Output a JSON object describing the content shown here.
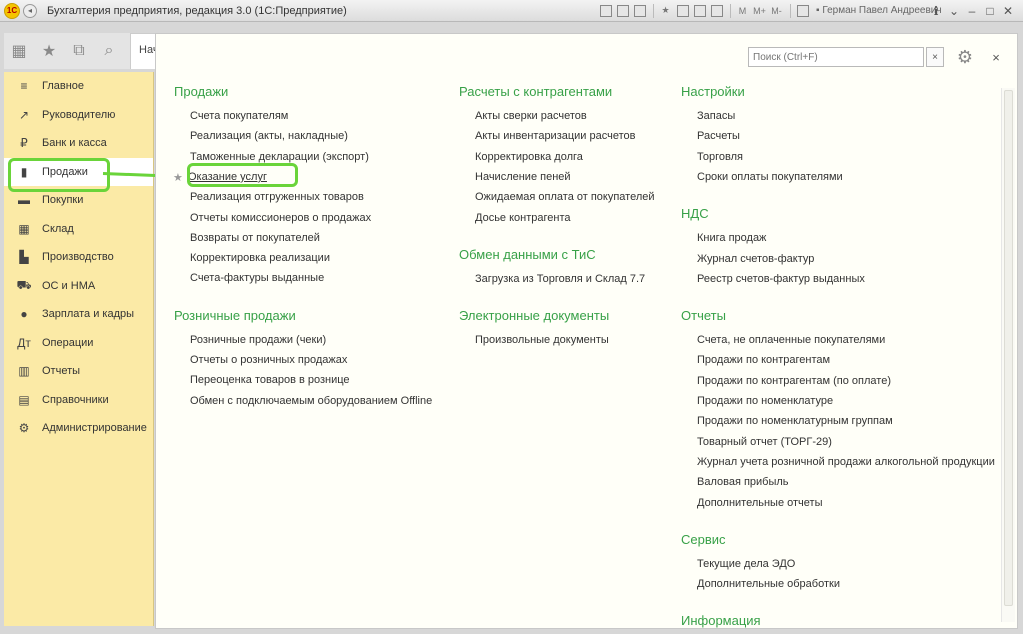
{
  "window": {
    "title": "Бухгалтерия предприятия, редакция 3.0  (1С:Предприятие)",
    "logo_text": "1С",
    "user": "Герман Павел Андреевич",
    "toolbar_letters": [
      "M",
      "M+",
      "M-"
    ]
  },
  "toolbar": {
    "tab_stub": "Нач"
  },
  "sidebar": {
    "items": [
      {
        "label": "Главное",
        "icon": "≡"
      },
      {
        "label": "Руководителю",
        "icon": "↗"
      },
      {
        "label": "Банк и касса",
        "icon": "₽"
      },
      {
        "label": "Продажи",
        "icon": "▮"
      },
      {
        "label": "Покупки",
        "icon": "▬"
      },
      {
        "label": "Склад",
        "icon": "▦"
      },
      {
        "label": "Производство",
        "icon": "▙"
      },
      {
        "label": "ОС и НМА",
        "icon": "⛟"
      },
      {
        "label": "Зарплата и кадры",
        "icon": "●"
      },
      {
        "label": "Операции",
        "icon": "Дт"
      },
      {
        "label": "Отчеты",
        "icon": "▥"
      },
      {
        "label": "Справочники",
        "icon": "▤"
      },
      {
        "label": "Администрирование",
        "icon": "⚙"
      }
    ]
  },
  "search": {
    "placeholder": "Поиск (Ctrl+F)",
    "clear": "×"
  },
  "close_label": "×",
  "gear_label": "⚙",
  "columns": [
    {
      "sections": [
        {
          "title": "Продажи",
          "links": [
            "Счета покупателям",
            "Реализация (акты, накладные)",
            "Таможенные декларации (экспорт)",
            "Оказание услуг",
            "Реализация отгруженных товаров",
            "Отчеты комиссионеров о продажах",
            "Возвраты от покупателей",
            "Корректировка реализации",
            "Счета-фактуры выданные"
          ]
        },
        {
          "title": "Розничные продажи",
          "links": [
            "Розничные продажи (чеки)",
            "Отчеты о розничных продажах",
            "Переоценка товаров в рознице",
            "Обмен с подключаемым оборудованием Offline"
          ]
        }
      ]
    },
    {
      "sections": [
        {
          "title": "Расчеты с контрагентами",
          "links": [
            "Акты сверки расчетов",
            "Акты инвентаризации расчетов",
            "Корректировка долга",
            "Начисление пеней",
            "Ожидаемая оплата от покупателей",
            "Досье контрагента"
          ]
        },
        {
          "title": "Обмен данными с ТиС",
          "links": [
            "Загрузка из Торговля и Склад 7.7"
          ]
        },
        {
          "title": "Электронные документы",
          "links": [
            "Произвольные документы"
          ]
        }
      ]
    },
    {
      "sections": [
        {
          "title": "Настройки",
          "links": [
            "Запасы",
            "Расчеты",
            "Торговля",
            "Сроки оплаты покупателями"
          ]
        },
        {
          "title": "НДС",
          "links": [
            "Книга продаж",
            "Журнал счетов-фактур",
            "Реестр счетов-фактур выданных"
          ]
        },
        {
          "title": "Отчеты",
          "links": [
            "Счета, не оплаченные покупателями",
            "Продажи по контрагентам",
            "Продажи по контрагентам (по оплате)",
            "Продажи по номенклатуре",
            "Продажи по номенклатурным группам",
            "Товарный отчет (ТОРГ-29)",
            "Журнал учета розничной продажи алкогольной продукции",
            "Валовая прибыль",
            "Дополнительные отчеты"
          ]
        },
        {
          "title": "Сервис",
          "links": [
            "Текущие дела ЭДО",
            "Дополнительные обработки"
          ]
        },
        {
          "title": "Информация",
          "links": []
        }
      ]
    }
  ],
  "colors": {
    "accent_green": "#38a148",
    "highlight": "#6ad43a",
    "sidebar_bg": "#fbeaa6"
  }
}
